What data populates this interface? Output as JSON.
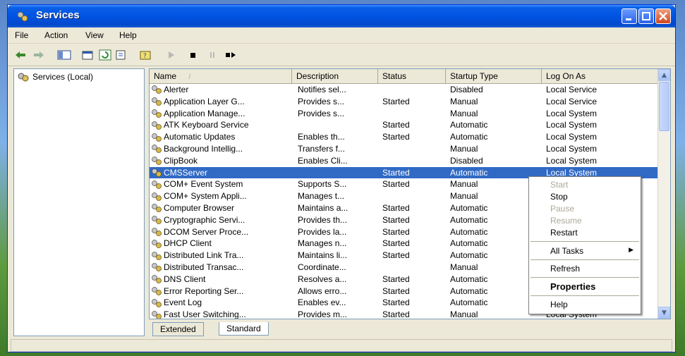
{
  "window": {
    "title": "Services"
  },
  "menu": [
    "File",
    "Action",
    "View",
    "Help"
  ],
  "tree": {
    "root": "Services (Local)"
  },
  "columns": [
    "Name",
    "Description",
    "Status",
    "Startup Type",
    "Log On As"
  ],
  "rows": [
    {
      "name": "Alerter",
      "desc": "Notifies sel...",
      "status": "",
      "startup": "Disabled",
      "logon": "Local Service"
    },
    {
      "name": "Application Layer G...",
      "desc": "Provides s...",
      "status": "Started",
      "startup": "Manual",
      "logon": "Local Service"
    },
    {
      "name": "Application Manage...",
      "desc": "Provides s...",
      "status": "",
      "startup": "Manual",
      "logon": "Local System"
    },
    {
      "name": "ATK Keyboard Service",
      "desc": "",
      "status": "Started",
      "startup": "Automatic",
      "logon": "Local System"
    },
    {
      "name": "Automatic Updates",
      "desc": "Enables th...",
      "status": "Started",
      "startup": "Automatic",
      "logon": "Local System"
    },
    {
      "name": "Background Intellig...",
      "desc": "Transfers f...",
      "status": "",
      "startup": "Manual",
      "logon": "Local System"
    },
    {
      "name": "ClipBook",
      "desc": "Enables Cli...",
      "status": "",
      "startup": "Disabled",
      "logon": "Local System"
    },
    {
      "name": "CMSServer",
      "desc": "",
      "status": "Started",
      "startup": "Automatic",
      "logon": "Local System",
      "selected": true
    },
    {
      "name": "COM+ Event System",
      "desc": "Supports S...",
      "status": "Started",
      "startup": "Manual",
      "logon": ""
    },
    {
      "name": "COM+ System Appli...",
      "desc": "Manages t...",
      "status": "",
      "startup": "Manual",
      "logon": ""
    },
    {
      "name": "Computer Browser",
      "desc": "Maintains a...",
      "status": "Started",
      "startup": "Automatic",
      "logon": ""
    },
    {
      "name": "Cryptographic Servi...",
      "desc": "Provides th...",
      "status": "Started",
      "startup": "Automatic",
      "logon": ""
    },
    {
      "name": "DCOM Server Proce...",
      "desc": "Provides la...",
      "status": "Started",
      "startup": "Automatic",
      "logon": ""
    },
    {
      "name": "DHCP Client",
      "desc": "Manages n...",
      "status": "Started",
      "startup": "Automatic",
      "logon": ""
    },
    {
      "name": "Distributed Link Tra...",
      "desc": "Maintains li...",
      "status": "Started",
      "startup": "Automatic",
      "logon": ""
    },
    {
      "name": "Distributed Transac...",
      "desc": "Coordinate...",
      "status": "",
      "startup": "Manual",
      "logon": ""
    },
    {
      "name": "DNS Client",
      "desc": "Resolves a...",
      "status": "Started",
      "startup": "Automatic",
      "logon": ""
    },
    {
      "name": "Error Reporting Ser...",
      "desc": "Allows erro...",
      "status": "Started",
      "startup": "Automatic",
      "logon": ""
    },
    {
      "name": "Event Log",
      "desc": "Enables ev...",
      "status": "Started",
      "startup": "Automatic",
      "logon": ""
    },
    {
      "name": "Fast User Switching...",
      "desc": "Provides m...",
      "status": "Started",
      "startup": "Manual",
      "logon": "Local System"
    }
  ],
  "tabs": [
    "Extended",
    "Standard"
  ],
  "context_menu": {
    "start": "Start",
    "stop": "Stop",
    "pause": "Pause",
    "resume": "Resume",
    "restart": "Restart",
    "all_tasks": "All Tasks",
    "refresh": "Refresh",
    "properties": "Properties",
    "help": "Help"
  },
  "colors": {
    "selection": "#316ac5",
    "titlebar": "#0054e3"
  }
}
